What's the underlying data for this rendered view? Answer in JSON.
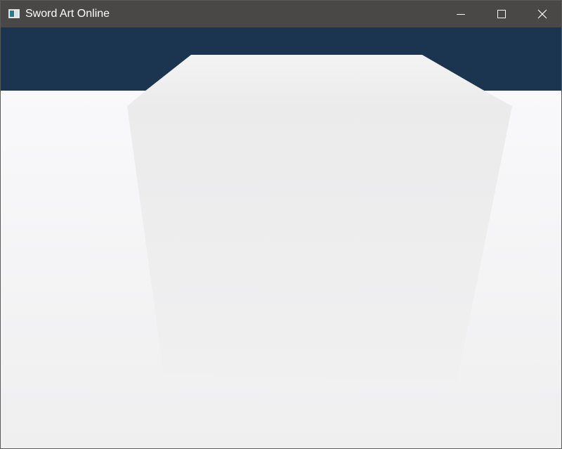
{
  "window": {
    "title": "Sword Art Online",
    "icon": "app-window-icon",
    "controls": {
      "minimize_icon": "minimize-icon",
      "maximize_icon": "maximize-icon",
      "close_icon": "close-icon"
    }
  },
  "scene": {
    "sky_color": "#1b3450",
    "ground_color": "#f7f7f9",
    "cube_color": "#ececed"
  }
}
